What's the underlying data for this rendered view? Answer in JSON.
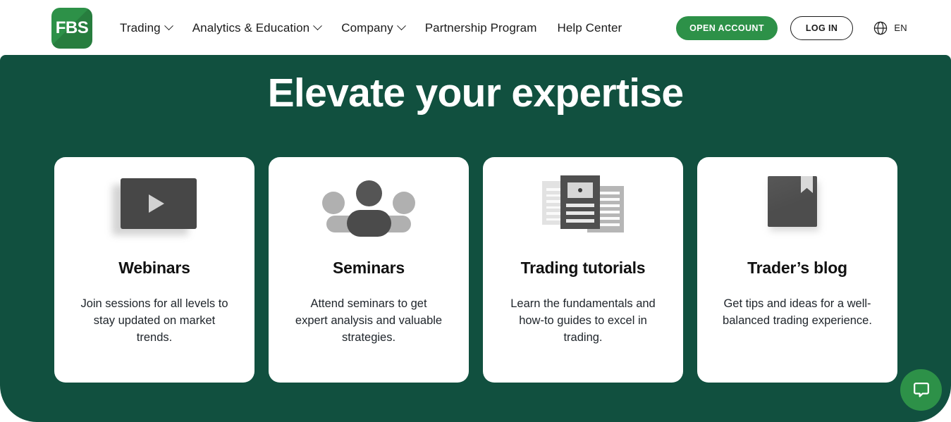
{
  "brand": {
    "logo_text": "FBS",
    "logo_color": "#2d9148"
  },
  "nav": {
    "items": [
      {
        "label": "Trading",
        "has_dropdown": true
      },
      {
        "label": "Analytics & Education",
        "has_dropdown": true
      },
      {
        "label": "Company",
        "has_dropdown": true
      },
      {
        "label": "Partnership Program",
        "has_dropdown": false
      },
      {
        "label": "Help Center",
        "has_dropdown": false
      }
    ],
    "open_account_label": "OPEN ACCOUNT",
    "log_in_label": "LOG IN",
    "language_code": "EN",
    "language_icon": "globe-icon"
  },
  "hero": {
    "title": "Elevate your expertise",
    "background_color": "#11503f",
    "cards": [
      {
        "icon": "video-play-icon",
        "title": "Webinars",
        "description": "Join sessions for all levels to stay updated on market trends."
      },
      {
        "icon": "people-group-icon",
        "title": "Seminars",
        "description": "Attend seminars to get expert analysis and valuable strategies."
      },
      {
        "icon": "documents-stack-icon",
        "title": "Trading tutorials",
        "description": "Learn the fundamentals and how-to guides to excel in trading."
      },
      {
        "icon": "book-bookmark-icon",
        "title": "Trader’s blog",
        "description": "Get tips and ideas for a well-balanced trading experience."
      }
    ]
  },
  "chat_widget": {
    "icon": "chat-bubble-icon",
    "color": "#2d9148"
  }
}
